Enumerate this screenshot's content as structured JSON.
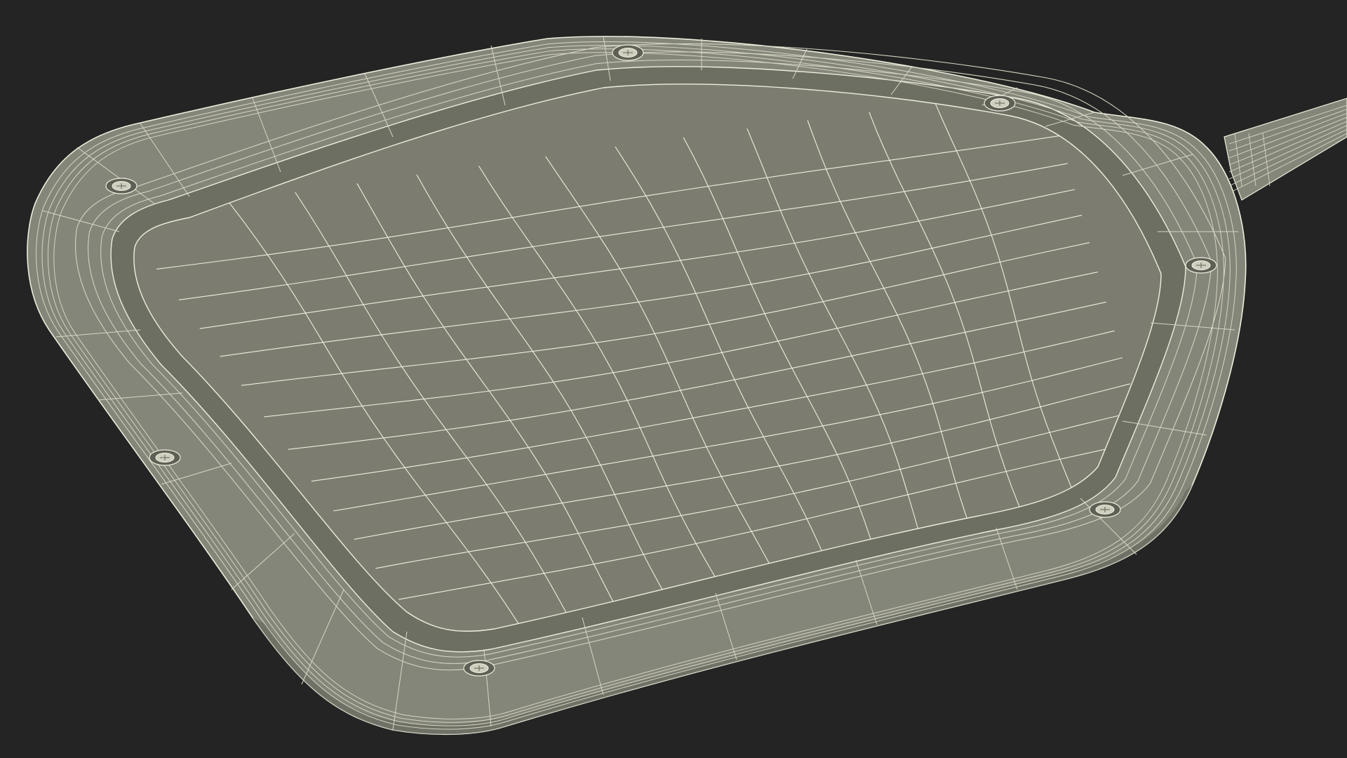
{
  "scene": {
    "subject": "wireframe-pan-model",
    "colors": {
      "background": "#242424",
      "surface": "#7c7d70",
      "surface_dark": "#6e6f63",
      "rim": "#85867a",
      "rim_shade": "#5f6055",
      "wire": "#eeeedd",
      "wire_dim": "#d6d6c4",
      "screw": "#cfcfbf"
    },
    "screws": [
      "screw-top-center",
      "screw-top-right",
      "screw-left",
      "screw-right-handle",
      "screw-lower-left",
      "screw-bottom",
      "screw-lower-right"
    ]
  }
}
